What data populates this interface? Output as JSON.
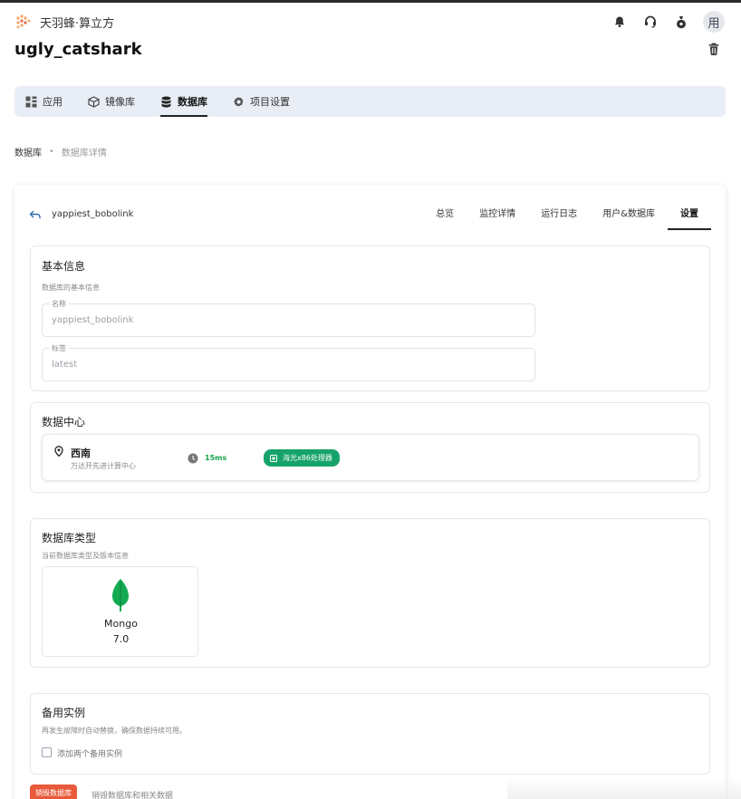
{
  "brand": {
    "name": "天羽蜂·算立方"
  },
  "header": {
    "avatar_text": "用",
    "icons": [
      "bell-icon",
      "headset-icon",
      "bag-icon"
    ]
  },
  "project": {
    "title": "ugly_catshark"
  },
  "nav": {
    "items": [
      {
        "label": "应用",
        "icon": "apps-icon",
        "active": false
      },
      {
        "label": "镜像库",
        "icon": "box-icon",
        "active": false
      },
      {
        "label": "数据库",
        "icon": "database-icon",
        "active": true
      },
      {
        "label": "项目设置",
        "icon": "gear-icon",
        "active": false
      }
    ]
  },
  "breadcrumb": {
    "root": "数据库",
    "separator": "•",
    "current": "数据库详情"
  },
  "detail": {
    "name": "yappiest_bobolink",
    "tabs": [
      {
        "label": "总览",
        "active": false
      },
      {
        "label": "监控详情",
        "active": false
      },
      {
        "label": "运行日志",
        "active": false
      },
      {
        "label": "用户&数据库",
        "active": false
      },
      {
        "label": "设置",
        "active": true
      }
    ]
  },
  "basic_info": {
    "title": "基本信息",
    "desc": "数据库的基本信息",
    "name_label": "名称",
    "name_value": "yappiest_bobolink",
    "tag_label": "标签",
    "tag_value": "latest"
  },
  "datacenter": {
    "title": "数据中心",
    "region": "西南",
    "site": "万达开先进计算中心",
    "latency": "15ms",
    "cpu": "海光x86处理器"
  },
  "db_type": {
    "title": "数据库类型",
    "desc": "当前数据库类型及版本信息",
    "name": "Mongo",
    "version": "7.0"
  },
  "standby": {
    "title": "备用实例",
    "desc": "再发生故障时自动替换，确保数据持续可用。",
    "checkbox_label": "添加两个备用实例",
    "checked": false
  },
  "danger": {
    "button": "销毁数据库",
    "text": "销毁数据库和相关数据"
  },
  "colors": {
    "accent_green": "#16a36b",
    "danger": "#e85a3a",
    "nav_bg": "#e9eef6"
  }
}
